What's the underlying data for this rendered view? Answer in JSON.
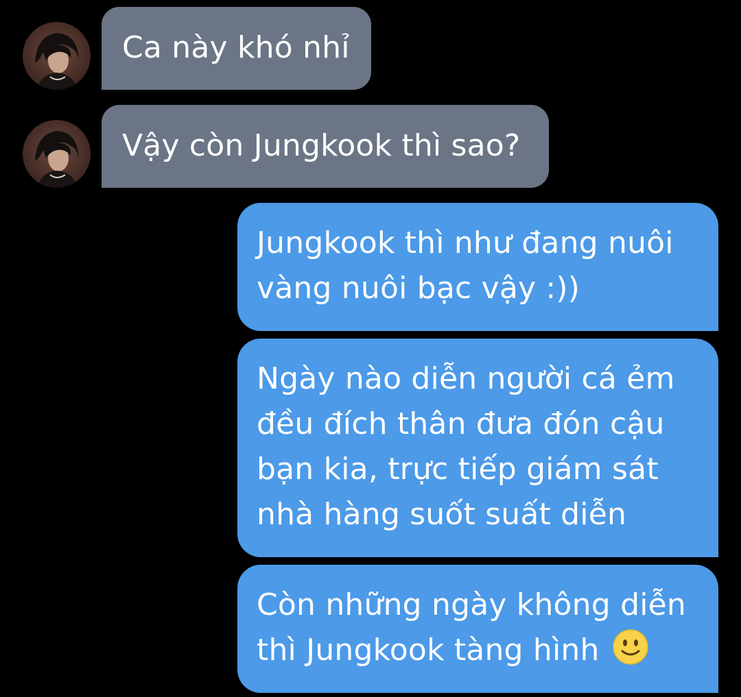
{
  "conversation": {
    "incoming": [
      {
        "text": "Ca này khó nhỉ"
      },
      {
        "text": "Vậy còn Jungkook thì sao?"
      }
    ],
    "outgoing": [
      {
        "lines": [
          "Jungkook thì như đang nuôi",
          "vàng nuôi bạc vậy :))"
        ]
      },
      {
        "lines": [
          "Ngày nào diễn người cá ẻm",
          "đều đích thân đưa đón cậu",
          "bạn kia, trực tiếp giám sát",
          "nhà hàng suốt suất diễn"
        ]
      },
      {
        "lines": [
          "Còn những ngày không diễn",
          "thì Jungkook tàng hình"
        ],
        "emoji": "slightly-smiling-face-icon"
      }
    ]
  },
  "colors": {
    "background": "#000000",
    "incoming_bubble": "#6b7585",
    "outgoing_bubble": "#4c9ae8",
    "text": "#ffffff"
  }
}
